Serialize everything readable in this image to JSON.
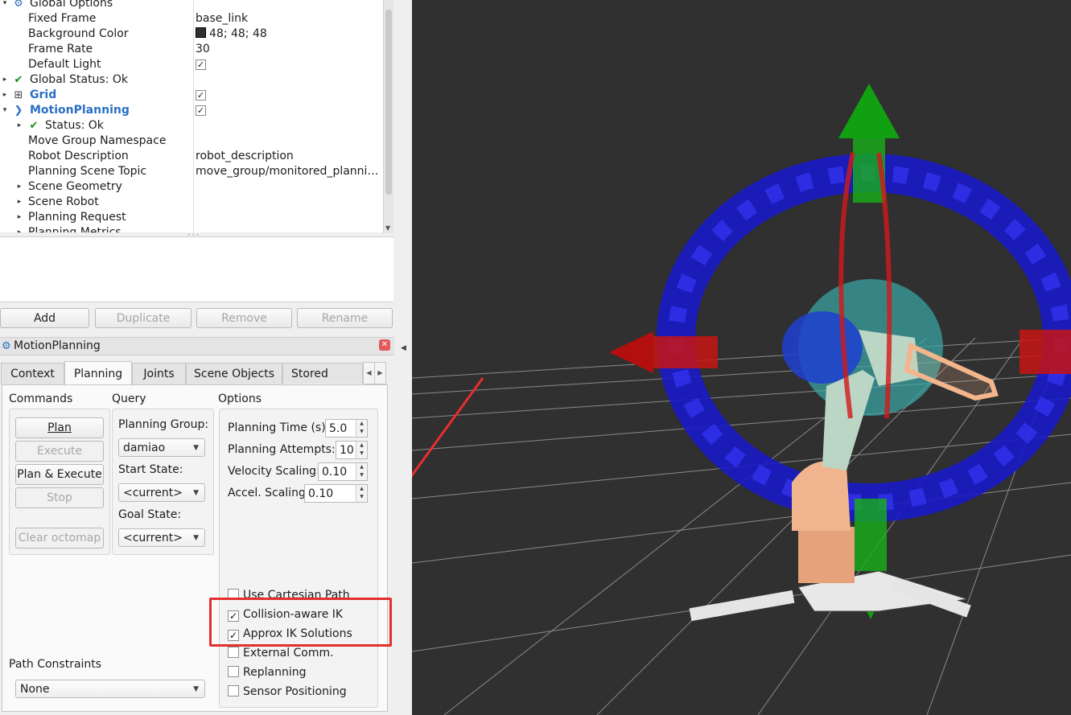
{
  "tree": {
    "rows": [
      {
        "name": "Global Options",
        "value": "",
        "indent": 1,
        "arrow": "expanded",
        "icon": "gear"
      },
      {
        "name": "Fixed Frame",
        "value": "base_link",
        "indent": 2
      },
      {
        "name": "Background Color",
        "value": "48; 48; 48",
        "indent": 2,
        "swatch": "#303030"
      },
      {
        "name": "Frame Rate",
        "value": "30",
        "indent": 2
      },
      {
        "name": "Default Light",
        "value": "",
        "indent": 2,
        "checked": true
      },
      {
        "name": "Global Status: Ok",
        "value": "",
        "indent": 1,
        "arrow": "collapsed",
        "icon": "check"
      },
      {
        "name": "Grid",
        "value": "",
        "indent": 1,
        "arrow": "collapsed",
        "icon": "grid",
        "bold": true,
        "checked": true
      },
      {
        "name": "MotionPlanning",
        "value": "",
        "indent": 1,
        "arrow": "expanded",
        "icon": "motion",
        "bold": true,
        "checked": true
      },
      {
        "name": "Status: Ok",
        "value": "",
        "indent": 2,
        "arrow": "collapsed",
        "icon": "check"
      },
      {
        "name": "Move Group Namespace",
        "value": "",
        "indent": 2
      },
      {
        "name": "Robot Description",
        "value": "robot_description",
        "indent": 2
      },
      {
        "name": "Planning Scene Topic",
        "value": "move_group/monitored_planni…",
        "indent": 2
      },
      {
        "name": "Scene Geometry",
        "value": "",
        "indent": 2,
        "arrow": "collapsed"
      },
      {
        "name": "Scene Robot",
        "value": "",
        "indent": 2,
        "arrow": "collapsed"
      },
      {
        "name": "Planning Request",
        "value": "",
        "indent": 2,
        "arrow": "collapsed"
      },
      {
        "name": "Planning Metrics",
        "value": "",
        "indent": 2,
        "arrow": "collapsed"
      }
    ]
  },
  "display_buttons": {
    "add": "Add",
    "duplicate": "Duplicate",
    "remove": "Remove",
    "rename": "Rename"
  },
  "panel": {
    "title": "MotionPlanning",
    "tabs": [
      "Context",
      "Planning",
      "Joints",
      "Scene Objects",
      "Stored Scene"
    ],
    "active_tab": "Planning",
    "commands": {
      "label": "Commands",
      "plan": "Plan",
      "execute": "Execute",
      "plan_execute": "Plan & Execute",
      "stop": "Stop",
      "clear_octomap": "Clear octomap"
    },
    "query": {
      "label": "Query",
      "planning_group_label": "Planning Group:",
      "planning_group": "damiao",
      "start_state_label": "Start State:",
      "start_state": "<current>",
      "goal_state_label": "Goal State:",
      "goal_state": "<current>"
    },
    "options": {
      "label": "Options",
      "planning_time_label": "Planning Time (s):",
      "planning_time": "5.0",
      "planning_attempts_label": "Planning Attempts:",
      "planning_attempts": "10",
      "velocity_scaling_label": "Velocity Scaling:",
      "velocity_scaling": "0.10",
      "accel_scaling_label": "Accel. Scaling:",
      "accel_scaling": "0.10",
      "checkboxes": [
        {
          "label": "Use Cartesian Path",
          "checked": false
        },
        {
          "label": "Collision-aware IK",
          "checked": true
        },
        {
          "label": "Approx IK Solutions",
          "checked": true
        },
        {
          "label": "External Comm.",
          "checked": false
        },
        {
          "label": "Replanning",
          "checked": false
        },
        {
          "label": "Sensor Positioning",
          "checked": false
        }
      ]
    },
    "path_constraints": {
      "label": "Path Constraints",
      "value": "None"
    }
  },
  "colors": {
    "viewport_bg": "#303030",
    "annotation": "#e62e2e",
    "link_blue": "#2a6fc4"
  }
}
